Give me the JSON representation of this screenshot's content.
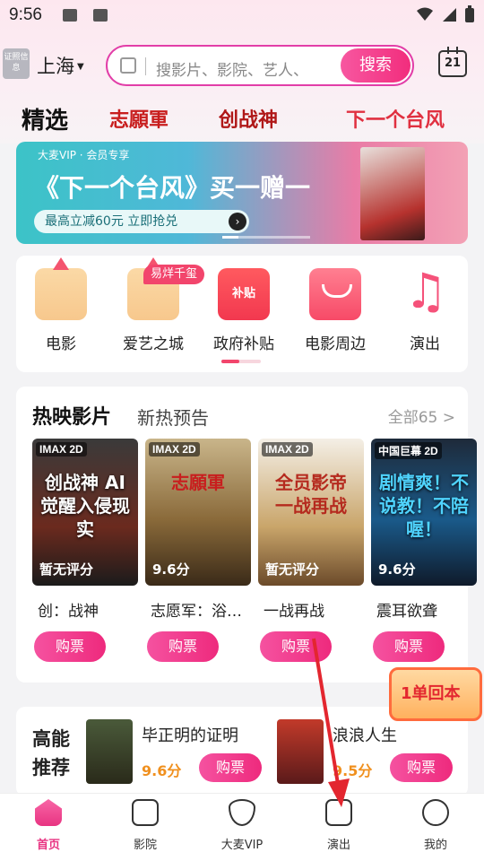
{
  "status_bar": {
    "time": "9:56"
  },
  "header": {
    "license_label": "证照信息",
    "city": "上海",
    "search_placeholder": "搜影片、影院、艺人、",
    "search_button": "搜索",
    "calendar_day": "21"
  },
  "category_strip": {
    "featured": "精选",
    "items": [
      "志願軍",
      "创战神",
      "下一个台风"
    ]
  },
  "banner": {
    "vip_label": "大麦VIP · 会员专享",
    "headline": "《下一个台风》买一赠一",
    "cta": "最高立减60元 立即抢兑"
  },
  "quick_entries": [
    {
      "label": "电影",
      "icon": "castle-icon"
    },
    {
      "label": "爱艺之城",
      "icon": "castle-icon"
    },
    {
      "label": "政府补贴",
      "icon": "subsidy-ticket-icon",
      "icon_text": "补贴"
    },
    {
      "label": "电影周边",
      "icon": "shopping-bag-icon"
    },
    {
      "label": "演出",
      "icon": "music-note-icon"
    }
  ],
  "quick_badge": "易烊千玺",
  "now_showing": {
    "tab_active": "热映影片",
    "tab_other": "新热预告",
    "all_label": "全部65 >",
    "movies": [
      {
        "format": "IMAX 2D",
        "poster_text": "创战神 AI觉醒入侵现实",
        "score": "暂无评分",
        "name": "创：战神",
        "buy": "购票"
      },
      {
        "format": "IMAX 2D",
        "poster_text": "志願軍",
        "score": "9.6分",
        "name": "志愿军：浴…",
        "buy": "购票"
      },
      {
        "format": "IMAX 2D",
        "poster_text": "全员影帝 一战再战",
        "score": "暂无评分",
        "name": "一战再战",
        "buy": "购票"
      },
      {
        "format": "中国巨幕 2D",
        "poster_text": "剧情爽！不说教！不陪喔！",
        "score": "9.6分",
        "name": "震耳欲聋",
        "buy": "购票"
      }
    ]
  },
  "promo_float": {
    "text": "1单回本"
  },
  "recommend": {
    "heading": "高能推荐",
    "items": [
      {
        "name": "毕正明的证明",
        "score": "9.6分",
        "buy": "购票"
      },
      {
        "name": "浪浪人生",
        "score": "9.5分",
        "buy": "购票"
      }
    ]
  },
  "bottom_nav": [
    {
      "label": "首页",
      "icon": "home-icon",
      "active": true
    },
    {
      "label": "影院",
      "icon": "cinema-icon"
    },
    {
      "label": "大麦VIP",
      "icon": "vip-diamond-icon"
    },
    {
      "label": "演出",
      "icon": "music-note-icon"
    },
    {
      "label": "我的",
      "icon": "profile-icon"
    }
  ],
  "colors": {
    "accent": "#ee2a7d",
    "brand_red": "#c81e1e",
    "score": "#f0901e"
  }
}
